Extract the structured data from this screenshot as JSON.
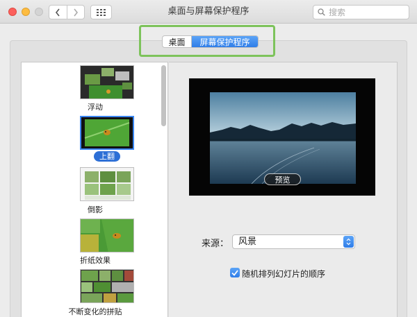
{
  "window": {
    "title": "桌面与屏幕保护程序"
  },
  "toolbar": {
    "search_placeholder": "搜索"
  },
  "tabs": [
    {
      "label": "桌面",
      "active": false
    },
    {
      "label": "屏幕保护程序",
      "active": true
    }
  ],
  "screensavers": [
    {
      "label": "浮动",
      "selected": false
    },
    {
      "label": "上翻",
      "selected": true
    },
    {
      "label": "倒影",
      "selected": false
    },
    {
      "label": "折纸效果",
      "selected": false
    },
    {
      "label": "不断变化的拼贴",
      "selected": false
    }
  ],
  "preview": {
    "button_label": "预览"
  },
  "source": {
    "label": "来源：",
    "value": "风景"
  },
  "shuffle": {
    "label": "随机排列幻灯片的顺序",
    "checked": true
  },
  "colors": {
    "accent": "#2f7de8",
    "highlight_box": "#7dc35b"
  }
}
